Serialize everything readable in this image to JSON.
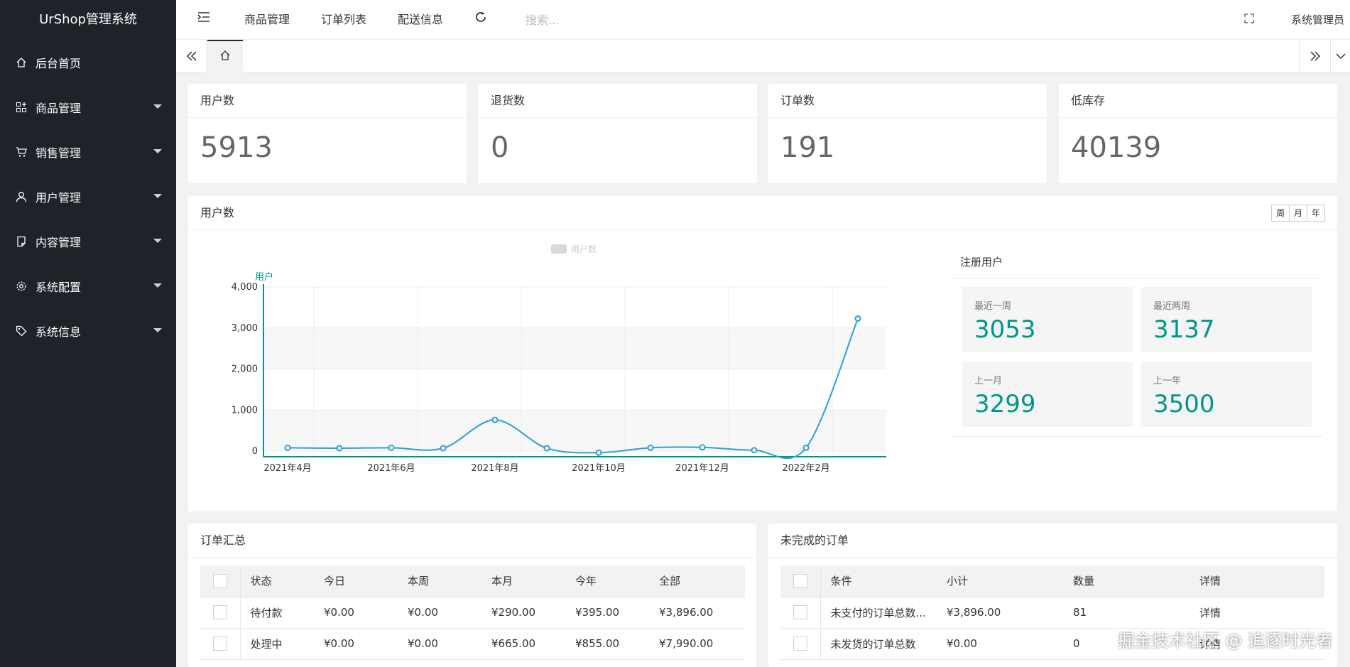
{
  "app": {
    "title": "UrShop管理系统"
  },
  "sidebar": {
    "items": [
      {
        "label": "后台首页",
        "icon": "home-icon",
        "has_submenu": false
      },
      {
        "label": "商品管理",
        "icon": "apps-icon",
        "has_submenu": true
      },
      {
        "label": "销售管理",
        "icon": "cart-icon",
        "has_submenu": true
      },
      {
        "label": "用户管理",
        "icon": "user-icon",
        "has_submenu": true
      },
      {
        "label": "内容管理",
        "icon": "note-icon",
        "has_submenu": true
      },
      {
        "label": "系统配置",
        "icon": "gear-icon",
        "has_submenu": true
      },
      {
        "label": "系统信息",
        "icon": "tag-icon",
        "has_submenu": true
      }
    ]
  },
  "topbar": {
    "menu_icon": "menu-fold-icon",
    "links": [
      "商品管理",
      "订单列表",
      "配送信息"
    ],
    "refresh_icon": "refresh-icon",
    "search_placeholder": "搜索...",
    "fullscreen_icon": "fullscreen-icon",
    "user": "系统管理员"
  },
  "tabs": {
    "prev_icon": "double-left-icon",
    "home_icon": "home-icon",
    "next_icon": "double-right-icon",
    "more_icon": "chevron-down-icon"
  },
  "stats": [
    {
      "title": "用户数",
      "value": "5913"
    },
    {
      "title": "退货数",
      "value": "0"
    },
    {
      "title": "订单数",
      "value": "191"
    },
    {
      "title": "低库存",
      "value": "40139"
    }
  ],
  "user_chart": {
    "title": "用户数",
    "periods": [
      "周",
      "月",
      "年"
    ],
    "chart_data": {
      "type": "line",
      "legend": "用户数",
      "ylabel": "用户",
      "ylim": [
        0,
        4000
      ],
      "yticks": [
        "4,000",
        "3,000",
        "2,000",
        "1,000",
        "0"
      ],
      "xtick_labels": [
        "2021年4月",
        "2021年6月",
        "2021年8月",
        "2021年10月",
        "2021年12月",
        "2022年2月"
      ],
      "series": [
        {
          "name": "用户数",
          "x": [
            "2021-04",
            "2021-05",
            "2021-06",
            "2021-07",
            "2021-08",
            "2021-09",
            "2021-10",
            "2021-11",
            "2021-12",
            "2022-01",
            "2022-02",
            "2022-03"
          ],
          "values": [
            80,
            70,
            80,
            70,
            760,
            70,
            -40,
            80,
            90,
            20,
            80,
            3230
          ]
        }
      ],
      "grid": true,
      "legend_position": "top"
    },
    "colors": {
      "line": "#2a9fd6",
      "axis": "#009688"
    }
  },
  "registered": {
    "title": "注册用户",
    "items": [
      {
        "label": "最近一周",
        "value": "3053"
      },
      {
        "label": "最近两周",
        "value": "3137"
      },
      {
        "label": "上一月",
        "value": "3299"
      },
      {
        "label": "上一年",
        "value": "3500"
      }
    ]
  },
  "order_summary": {
    "title": "订单汇总",
    "headers": [
      "状态",
      "今日",
      "本周",
      "本月",
      "今年",
      "全部"
    ],
    "rows": [
      [
        "待付款",
        "¥0.00",
        "¥0.00",
        "¥290.00",
        "¥395.00",
        "¥3,896.00"
      ],
      [
        "处理中",
        "¥0.00",
        "¥0.00",
        "¥665.00",
        "¥855.00",
        "¥7,990.00"
      ]
    ]
  },
  "pending_orders": {
    "title": "未完成的订单",
    "headers": [
      "条件",
      "小计",
      "数量",
      "详情"
    ],
    "rows": [
      [
        "未支付的订单总数...",
        "¥3,896.00",
        "81",
        "详情"
      ],
      [
        "未发货的订单总数",
        "¥0.00",
        "0",
        "详情"
      ]
    ]
  },
  "watermark": "掘金技术社区 @ 追逐时光者"
}
